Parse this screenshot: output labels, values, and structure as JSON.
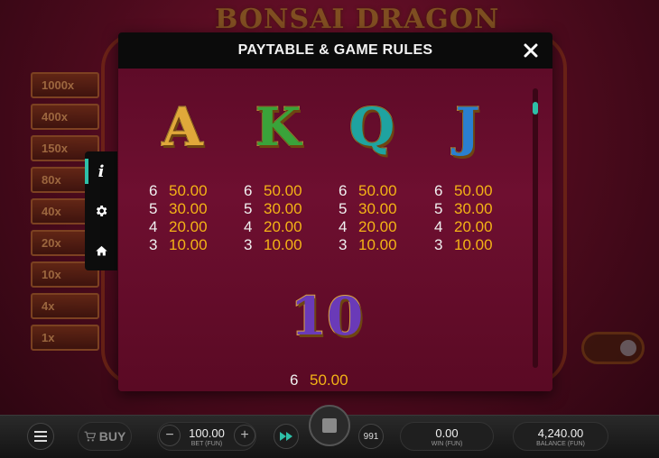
{
  "background": {
    "game_title": "BONSAI DRAGON",
    "multipliers": [
      "1000x",
      "400x",
      "150x",
      "80x",
      "40x",
      "20x",
      "10x",
      "4x",
      "1x"
    ]
  },
  "modal": {
    "title": "PAYTABLE & GAME RULES",
    "symbols": [
      {
        "letter": "A",
        "color": "#e0a83a",
        "pays": [
          {
            "count": "6",
            "value": "50.00"
          },
          {
            "count": "5",
            "value": "30.00"
          },
          {
            "count": "4",
            "value": "20.00"
          },
          {
            "count": "3",
            "value": "10.00"
          }
        ]
      },
      {
        "letter": "K",
        "color": "#3aa33a",
        "pays": [
          {
            "count": "6",
            "value": "50.00"
          },
          {
            "count": "5",
            "value": "30.00"
          },
          {
            "count": "4",
            "value": "20.00"
          },
          {
            "count": "3",
            "value": "10.00"
          }
        ]
      },
      {
        "letter": "Q",
        "color": "#1fa3a0",
        "pays": [
          {
            "count": "6",
            "value": "50.00"
          },
          {
            "count": "5",
            "value": "30.00"
          },
          {
            "count": "4",
            "value": "20.00"
          },
          {
            "count": "3",
            "value": "10.00"
          }
        ]
      },
      {
        "letter": "J",
        "color": "#2a7fd0",
        "pays": [
          {
            "count": "6",
            "value": "50.00"
          },
          {
            "count": "5",
            "value": "30.00"
          },
          {
            "count": "4",
            "value": "20.00"
          },
          {
            "count": "3",
            "value": "10.00"
          }
        ]
      }
    ],
    "ten_symbol": {
      "label": "10",
      "color": "#6a3ab8",
      "pays": [
        {
          "count": "6",
          "value": "50.00"
        }
      ]
    },
    "scroll_position_fraction": 0.05
  },
  "side_tabs": [
    {
      "icon": "info-icon",
      "active": true
    },
    {
      "icon": "gear-icon",
      "active": false
    },
    {
      "icon": "home-icon",
      "active": false
    }
  ],
  "bottom_bar": {
    "buy_label": "BUY",
    "bet_value": "100.00",
    "bet_label": "BET (FUN)",
    "autoplay_count": "991",
    "win_value": "0.00",
    "win_label": "WIN (FUN)",
    "balance_value": "4,240.00",
    "balance_label": "BALANCE (FUN)"
  },
  "colors": {
    "accent": "#2ec0a8",
    "pay_value": "#f3b316",
    "modal_bg": "#640c2b"
  }
}
